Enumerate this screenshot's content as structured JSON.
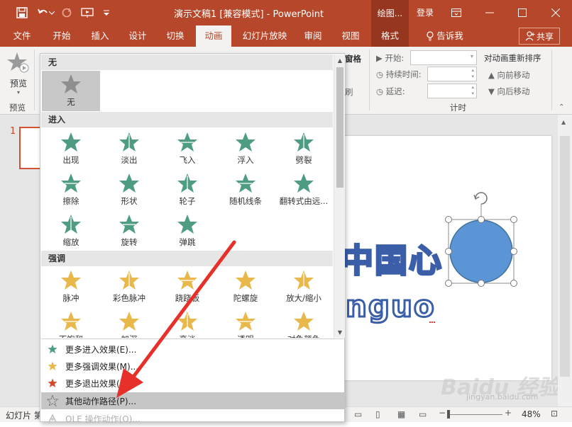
{
  "titlebar": {
    "title": "演示文稿1 [兼容模式] - PowerPoint",
    "context_title": "绘图...",
    "login": "登录"
  },
  "tabs": [
    {
      "label": "文件"
    },
    {
      "label": "开始"
    },
    {
      "label": "插入"
    },
    {
      "label": "设计"
    },
    {
      "label": "切换"
    },
    {
      "label": "动画"
    },
    {
      "label": "幻灯片放映"
    },
    {
      "label": "审阅"
    },
    {
      "label": "视图"
    },
    {
      "label": "格式"
    },
    {
      "label": "告诉我"
    }
  ],
  "share_label": "共享",
  "ribbon": {
    "preview_label": "预览",
    "preview_group": "预览",
    "partial_a": "窗格",
    "partial_b": "刷",
    "start_label": "开始:",
    "duration_label": "持续时间:",
    "delay_label": "延迟:",
    "reorder_title": "对动画重新排序",
    "move_earlier": "向前移动",
    "move_later": "向后移动",
    "timing_group": "计时"
  },
  "slides": {
    "number": "1"
  },
  "slide_content": {
    "partial_text_1": "中国心",
    "partial_text_2": "nguo",
    "watermark": "Baidu 经验",
    "watermark_url": "jingyan.baidu.com"
  },
  "gallery": {
    "none_header": "无",
    "none_item": "无",
    "entrance_header": "进入",
    "entrance": [
      "出现",
      "淡出",
      "飞入",
      "浮入",
      "劈裂",
      "擦除",
      "形状",
      "轮子",
      "随机线条",
      "翻转式由远...",
      "缩放",
      "旋转",
      "弹跳"
    ],
    "emphasis_header": "强调",
    "emphasis": [
      "脉冲",
      "彩色脉冲",
      "跷跷板",
      "陀螺旋",
      "放大/缩小",
      "不饱和",
      "加深",
      "变淡",
      "透明",
      "对象颜色"
    ]
  },
  "menu": [
    {
      "label": "更多进入效果(E)...",
      "icon": "green-star-icon"
    },
    {
      "label": "更多强调效果(M)...",
      "icon": "gold-star-icon"
    },
    {
      "label": "更多退出效果(X)...",
      "icon": "red-star-icon"
    },
    {
      "label": "其他动作路径(P)...",
      "icon": "path-star-icon"
    },
    {
      "label": "OLE 操作动作(O)...",
      "icon": "ole-icon"
    }
  ],
  "status": {
    "slide_info": "幻灯片 第",
    "zoom": "48%"
  },
  "colors": {
    "accent": "#b7472a",
    "entrance_star": "#4e9d82",
    "emphasis_star": "#e8b94a",
    "exit_star": "#d9472b",
    "shape_fill": "#5b95d5",
    "arrow": "#e8302a"
  }
}
